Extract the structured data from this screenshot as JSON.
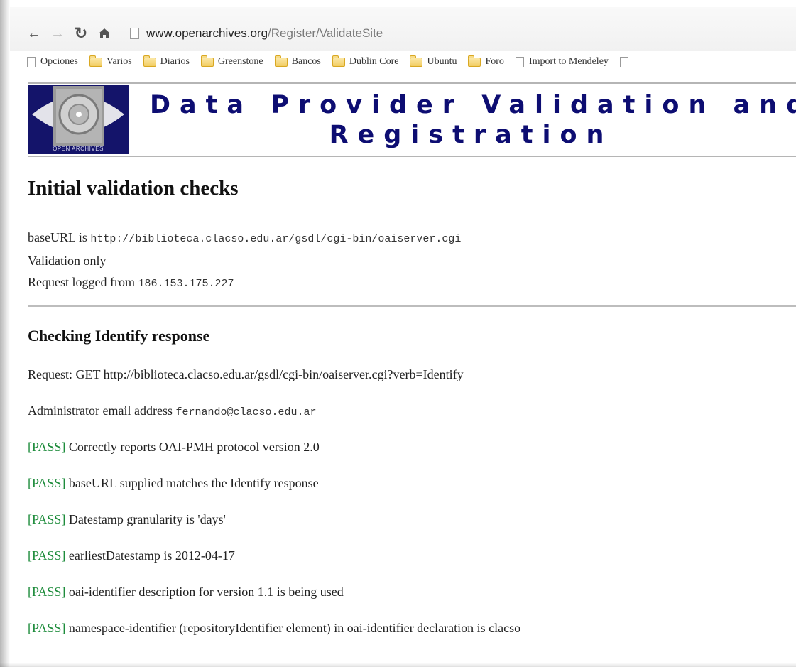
{
  "browser": {
    "url_domain": "www.openarchives.org",
    "url_path": "/Register/ValidateSite",
    "bookmarks": [
      {
        "label": "Opciones",
        "icon": "page-icon"
      },
      {
        "label": "Varios",
        "icon": "folder-icon"
      },
      {
        "label": "Diarios",
        "icon": "folder-icon"
      },
      {
        "label": "Greenstone",
        "icon": "folder-icon"
      },
      {
        "label": "Bancos",
        "icon": "folder-icon"
      },
      {
        "label": "Dublin Core",
        "icon": "folder-icon"
      },
      {
        "label": "Ubuntu",
        "icon": "folder-icon"
      },
      {
        "label": "Foro",
        "icon": "folder-icon"
      },
      {
        "label": "Import to Mendeley",
        "icon": "page-icon"
      }
    ]
  },
  "banner": {
    "logo_caption": "OPEN ARCHIVES",
    "title_line1": "Data Provider Validation and",
    "title_line2": "Registration",
    "logo_bg": "#14146a",
    "title_color": "#0d0d72"
  },
  "initial": {
    "heading": "Initial validation checks",
    "baseurl_label": "baseURL is",
    "baseurl_value": "http://biblioteca.clacso.edu.ar/gsdl/cgi-bin/oaiserver.cgi",
    "mode": "Validation only",
    "request_label": "Request logged from",
    "request_ip": "186.153.175.227"
  },
  "identify": {
    "heading": "Checking Identify response",
    "request": "Request: GET http://biblioteca.clacso.edu.ar/gsdl/cgi-bin/oaiserver.cgi?verb=Identify",
    "admin_label": "Administrator email address",
    "admin_email": "fernando@clacso.edu.ar",
    "pass_color": "#1e8c3c",
    "checks": [
      {
        "status": "[PASS]",
        "text": "Correctly reports OAI-PMH protocol version 2.0"
      },
      {
        "status": "[PASS]",
        "text": "baseURL supplied matches the Identify response"
      },
      {
        "status": "[PASS]",
        "text": "Datestamp granularity is 'days'"
      },
      {
        "status": "[PASS]",
        "text": "earliestDatestamp is 2012-04-17"
      },
      {
        "status": "[PASS]",
        "text": "oai-identifier description for version 1.1 is being used"
      },
      {
        "status": "[PASS]",
        "text": "namespace-identifier (repositoryIdentifier element) in oai-identifier declaration is clacso"
      }
    ]
  }
}
